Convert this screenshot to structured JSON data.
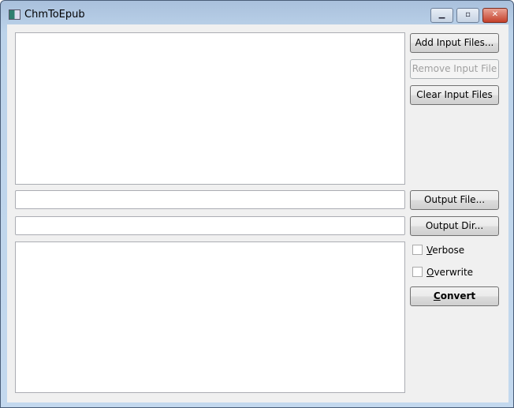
{
  "window": {
    "title": "ChmToEpub",
    "minimize": "▁",
    "maximize": "▫",
    "close": "✕"
  },
  "buttons": {
    "add": "Add Input Files...",
    "remove": "Remove Input File",
    "clear": "Clear Input Files",
    "output_file": "Output File...",
    "output_dir": "Output Dir...",
    "convert_mn": "C",
    "convert_rest": "onvert"
  },
  "fields": {
    "output_file": "",
    "output_dir": ""
  },
  "options": {
    "verbose_mn": "V",
    "verbose_rest": "erbose",
    "verbose_checked": false,
    "overwrite_mn": "O",
    "overwrite_rest": "verwrite",
    "overwrite_checked": false
  }
}
